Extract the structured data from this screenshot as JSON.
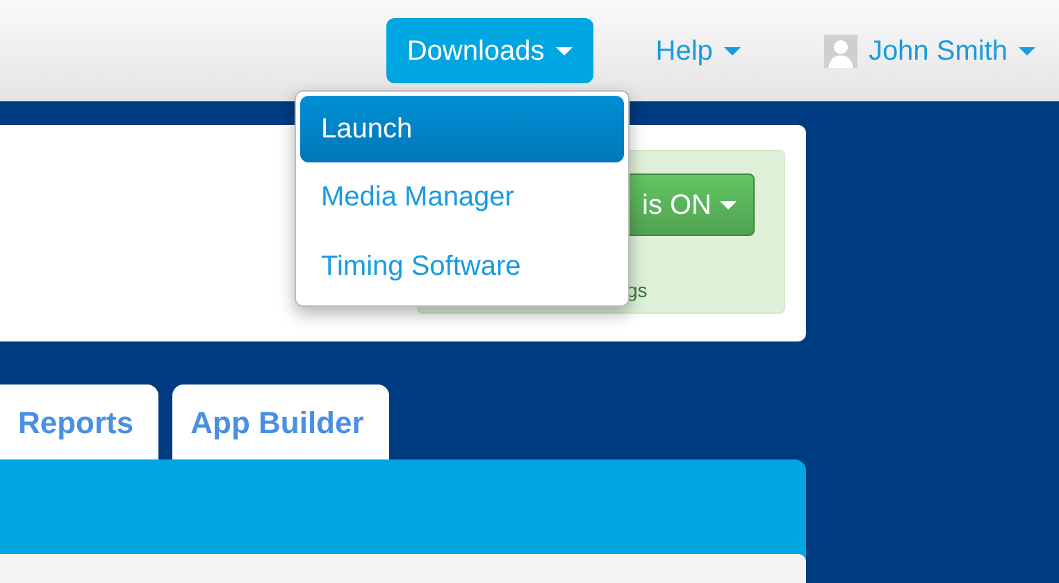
{
  "navbar": {
    "menus": [
      {
        "label": "Downloads",
        "open": true
      },
      {
        "label": "Help",
        "open": false
      },
      {
        "label": "John Smith",
        "open": false,
        "kind": "user"
      }
    ]
  },
  "downloads_menu": {
    "items": [
      {
        "label": "Launch",
        "selected": true
      },
      {
        "label": "Media Manager",
        "selected": false
      },
      {
        "label": "Timing Software",
        "selected": false
      }
    ]
  },
  "status_panel": {
    "button": "is ON",
    "note": "gs"
  },
  "tabs": [
    {
      "label": "Reports"
    },
    {
      "label": "App Builder"
    }
  ]
}
